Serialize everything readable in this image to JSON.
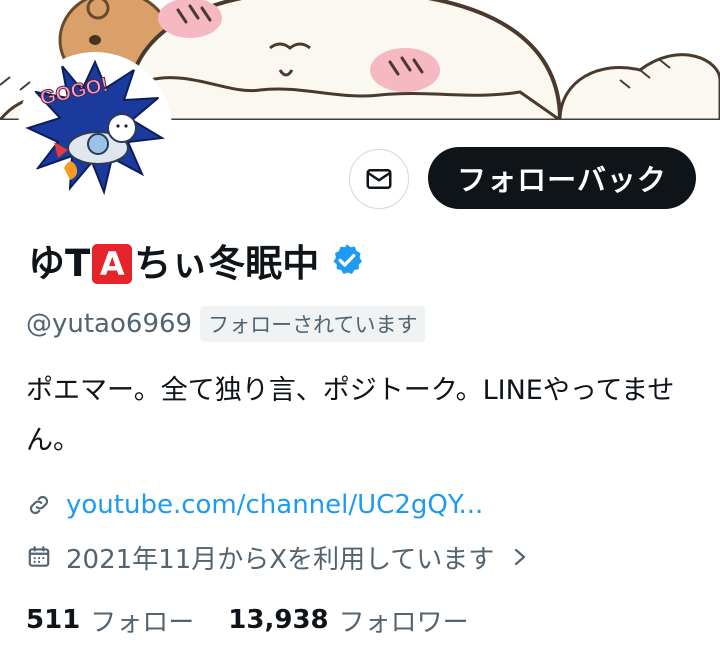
{
  "profile": {
    "name_prefix": "ゆT",
    "name_badge": "A",
    "name_suffix": "ちぃ冬眠中",
    "handle": "@yutao6969",
    "follows_you_label": "フォローされています",
    "bio": "ポエマー。全て独り言、ポジトーク。LINEやってません。",
    "link": "youtube.com/channel/UC2gQY...",
    "joined": "2021年11月からXを利用しています",
    "avatar_text": "GOGO!"
  },
  "actions": {
    "follow_back_label": "フォローバック"
  },
  "stats": {
    "following_count": "511",
    "following_label": "フォロー",
    "followers_count": "13,938",
    "followers_label": "フォロワー"
  },
  "colors": {
    "accent_blue": "#1d9bf0",
    "badge_red": "#e3242b",
    "button_black": "#0f1419",
    "muted_text": "#536471"
  },
  "icons": {
    "message": "envelope-icon",
    "verified": "verified-badge-icon",
    "link": "link-icon",
    "calendar": "calendar-icon",
    "chevron": "chevron-right-icon"
  }
}
